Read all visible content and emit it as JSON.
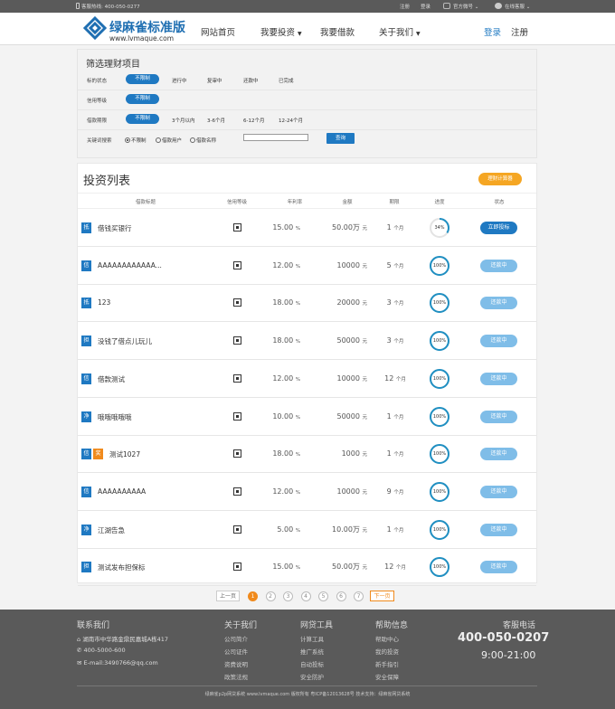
{
  "topbar": {
    "hotline": "客服热线: 400-050-0277",
    "register": "注册",
    "login": "登录",
    "wechat": "官方微号",
    "online": "在线客服"
  },
  "header": {
    "logo_title": "绿麻雀标准版",
    "logo_url": "www.lvmaque.com",
    "nav": [
      "网站首页",
      "我要投资",
      "我要借款",
      "关于我们"
    ],
    "login": "登录",
    "register": "注册"
  },
  "filter": {
    "title": "筛选理财项目",
    "rows": [
      {
        "label": "标的状态",
        "options": [
          "不限制",
          "进行中",
          "复审中",
          "还款中",
          "已完成"
        ]
      },
      {
        "label": "信用等级",
        "options": [
          "不限制"
        ]
      },
      {
        "label": "借款期限",
        "options": [
          "不限制",
          "3个月以内",
          "3-6个月",
          "6-12个月",
          "12-24个月"
        ]
      }
    ],
    "keyword_label": "关键词搜索",
    "radios": [
      "不限制",
      "借款用户",
      "借款名称"
    ],
    "query": "查询"
  },
  "list": {
    "title": "投资列表",
    "calc": "理财计算器",
    "headers": [
      "借款标题",
      "信用等级",
      "年利率",
      "金额",
      "期限",
      "进度",
      "状态"
    ],
    "rows": [
      {
        "badges": [
          {
            "t": "抵",
            "c": "#1f79c2"
          }
        ],
        "name": "借钱买银行",
        "rate": "15.00",
        "amount": "50.00万",
        "amount_unit": "元",
        "term": "1",
        "term_unit": "个月",
        "progress": 34,
        "progress_label": "34%",
        "status": "立即投标",
        "status_active": true
      },
      {
        "badges": [
          {
            "t": "信",
            "c": "#1f79c2"
          }
        ],
        "name": "AAAAAAAAAAAA...",
        "rate": "12.00",
        "amount": "10000",
        "amount_unit": "元",
        "term": "5",
        "term_unit": "个月",
        "progress": 100,
        "progress_label": "100%",
        "status": "还款中",
        "status_active": false
      },
      {
        "badges": [
          {
            "t": "抵",
            "c": "#1f79c2"
          }
        ],
        "name": "123",
        "rate": "18.00",
        "amount": "20000",
        "amount_unit": "元",
        "term": "3",
        "term_unit": "个月",
        "progress": 100,
        "progress_label": "100%",
        "status": "还款中",
        "status_active": false
      },
      {
        "badges": [
          {
            "t": "担",
            "c": "#1f79c2"
          }
        ],
        "name": "没钱了借点儿玩儿",
        "rate": "18.00",
        "amount": "50000",
        "amount_unit": "元",
        "term": "3",
        "term_unit": "个月",
        "progress": 100,
        "progress_label": "100%",
        "status": "还款中",
        "status_active": false
      },
      {
        "badges": [
          {
            "t": "信",
            "c": "#1f79c2"
          }
        ],
        "name": "借款测试",
        "rate": "12.00",
        "amount": "10000",
        "amount_unit": "元",
        "term": "12",
        "term_unit": "个月",
        "progress": 100,
        "progress_label": "100%",
        "status": "还款中",
        "status_active": false
      },
      {
        "badges": [
          {
            "t": "净",
            "c": "#1f79c2"
          }
        ],
        "name": "哦哦哦哦哦",
        "rate": "10.00",
        "amount": "50000",
        "amount_unit": "元",
        "term": "1",
        "term_unit": "个月",
        "progress": 100,
        "progress_label": "100%",
        "status": "还款中",
        "status_active": false
      },
      {
        "badges": [
          {
            "t": "信",
            "c": "#1f79c2"
          },
          {
            "t": "奖",
            "c": "#f08a1c"
          }
        ],
        "name": "测试1027",
        "rate": "18.00",
        "amount": "1000",
        "amount_unit": "元",
        "term": "1",
        "term_unit": "个月",
        "progress": 100,
        "progress_label": "100%",
        "status": "还款中",
        "status_active": false
      },
      {
        "badges": [
          {
            "t": "信",
            "c": "#1f79c2"
          }
        ],
        "name": "AAAAAAAAAA",
        "rate": "12.00",
        "amount": "10000",
        "amount_unit": "元",
        "term": "9",
        "term_unit": "个月",
        "progress": 100,
        "progress_label": "100%",
        "status": "还款中",
        "status_active": false
      },
      {
        "badges": [
          {
            "t": "净",
            "c": "#1f79c2"
          }
        ],
        "name": "江湖告急",
        "rate": "5.00",
        "amount": "10.00万",
        "amount_unit": "元",
        "term": "1",
        "term_unit": "个月",
        "progress": 100,
        "progress_label": "100%",
        "status": "还款中",
        "status_active": false
      },
      {
        "badges": [
          {
            "t": "担",
            "c": "#1f79c2"
          }
        ],
        "name": "测试发布担保标",
        "rate": "15.00",
        "amount": "50.00万",
        "amount_unit": "元",
        "term": "12",
        "term_unit": "个月",
        "progress": 100,
        "progress_label": "100%",
        "status": "还款中",
        "status_active": false
      }
    ],
    "percent_sign": "%"
  },
  "pager": {
    "prev": "上一页",
    "next": "下一页",
    "pages": [
      "1",
      "2",
      "3",
      "4",
      "5",
      "6",
      "7"
    ],
    "current": "1"
  },
  "footer": {
    "contact_title": "联系我们",
    "address": "湖南市中华路金鼎民嘉城A栋417",
    "phone": "400-5000-600",
    "email": "E-mail:3490766@qq.com",
    "about_title": "关于我们",
    "about_items": [
      "公司简介",
      "公司证件",
      "资费说明",
      "政策法规"
    ],
    "tools_title": "网贷工具",
    "tools_items": [
      "计算工具",
      "推广系统",
      "自动投标",
      "安全防护"
    ],
    "help_title": "帮助信息",
    "help_items": [
      "帮助中心",
      "我的投资",
      "新手指引",
      "安全保障"
    ],
    "service_title": "客服电话",
    "service_phone": "400-050-0207",
    "service_hours": "9:00-21:00",
    "copyright": "绿麻雀p2p网贷系统 www.lvmaque.com 版权所有 粤ICP备12013628号 技术支持：绿麻雀网贷系统"
  },
  "colors": {
    "primary": "#1f79c2",
    "accent": "#f08a1c",
    "progress": "#1f8fc2",
    "inactive_button": "#7fbde8"
  }
}
